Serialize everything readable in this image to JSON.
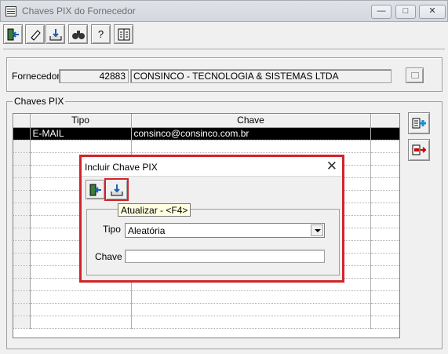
{
  "window": {
    "title": "Chaves PIX do Fornecedor",
    "minimize": "—",
    "maximize": "□",
    "close": "✕"
  },
  "toolbar": {
    "buttons": [
      {
        "icon": "exit-icon"
      },
      {
        "icon": "eraser-icon"
      },
      {
        "icon": "save-tray-icon"
      },
      {
        "icon": "binoculars-icon"
      },
      {
        "icon": "help-icon",
        "label": "?"
      },
      {
        "icon": "report-icon"
      }
    ]
  },
  "fornecedor": {
    "label": "Fornecedor",
    "code": "42883",
    "name": "CONSINCO - TECNOLOGIA & SISTEMAS LTDA"
  },
  "chaves": {
    "group_title": "Chaves PIX",
    "columns": [
      "Tipo",
      "Chave"
    ],
    "rows": [
      {
        "tipo": "E-MAIL",
        "chave": "consinco@consinco.com.br"
      }
    ]
  },
  "dialog": {
    "title": "Incluir Chave PIX",
    "close": "✕",
    "tooltip": "Atualizar - <F4>",
    "tipo_label": "Tipo",
    "tipo_value": "Aleatória",
    "chave_label": "Chave",
    "chave_value": ""
  },
  "colors": {
    "highlight": "#d2232a",
    "selected_row": "#000000",
    "tooltip_bg": "#ffffe1"
  }
}
